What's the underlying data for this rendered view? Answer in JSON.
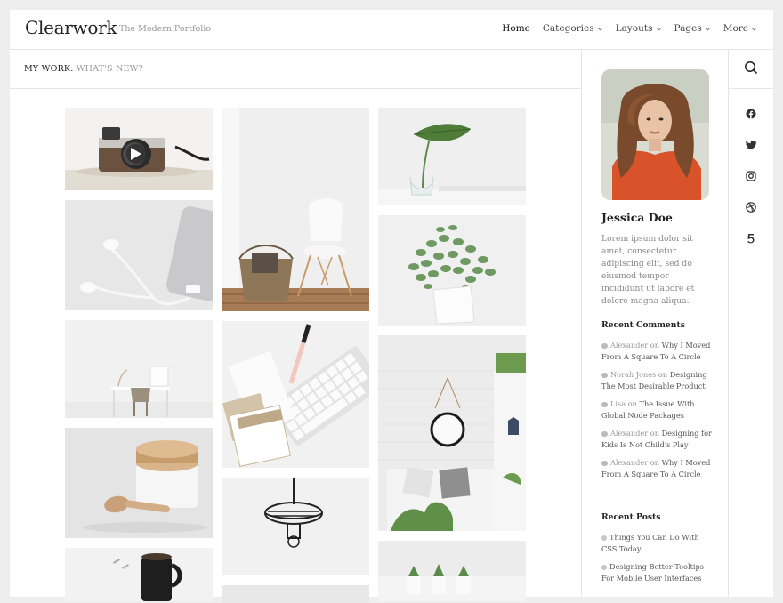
{
  "header": {
    "logo": "Clearwork",
    "tagline": "The Modern Portfolio",
    "nav": [
      {
        "label": "Home",
        "dropdown": false
      },
      {
        "label": "Categories",
        "dropdown": true
      },
      {
        "label": "Layouts",
        "dropdown": true
      },
      {
        "label": "Pages",
        "dropdown": true
      },
      {
        "label": "More",
        "dropdown": true
      }
    ]
  },
  "subbar": {
    "primary": "MY WORK.",
    "secondary": "WHAT'S NEW?"
  },
  "gallery": [
    {
      "subject": "vintage camera with play button"
    },
    {
      "subject": "earphones and phone"
    },
    {
      "subject": "minimal desk with chair"
    },
    {
      "subject": "wooden jar and scoop"
    },
    {
      "subject": "coffee mug with clips"
    },
    {
      "subject": "white chair with basket"
    },
    {
      "subject": "keyboard with swatches and pen"
    },
    {
      "subject": "hanging pendant lamp"
    },
    {
      "subject": "monstera leaf in vase"
    },
    {
      "subject": "eucalyptus in bag"
    },
    {
      "subject": "mirror and sofa interior"
    },
    {
      "subject": "potted succulents"
    }
  ],
  "sidebar": {
    "author_name": "Jessica Doe",
    "bio": "Lorem ipsum dolor sit amet, consectetur adipiscing elit, sed do eiusmod tempor incididunt ut labore et dolore magna aliqua.",
    "recent_comments_title": "Recent Comments",
    "comments": [
      {
        "author": "Alexander",
        "on": "on",
        "title": "Why I Moved From A Square To A Circle"
      },
      {
        "author": "Norah Jones",
        "on": "on",
        "title": "Designing The Most Desirable Product"
      },
      {
        "author": "Lisa",
        "on": "on",
        "title": "The Issue With Global Node Packages"
      },
      {
        "author": "Alexander",
        "on": "on",
        "title": "Designing for Kids Is Not Child's Play"
      },
      {
        "author": "Alexander",
        "on": "on",
        "title": "Why I Moved From A Square To A Circle"
      }
    ],
    "recent_posts_title": "Recent Posts",
    "posts": [
      {
        "title": "Things You Can Do With CSS Today"
      },
      {
        "title": "Designing Better Tooltips For Mobile User Interfaces"
      }
    ]
  },
  "right_icons": [
    "search-icon",
    "facebook-icon",
    "twitter-icon",
    "instagram-icon",
    "dribbble-icon",
    "500px-icon"
  ]
}
